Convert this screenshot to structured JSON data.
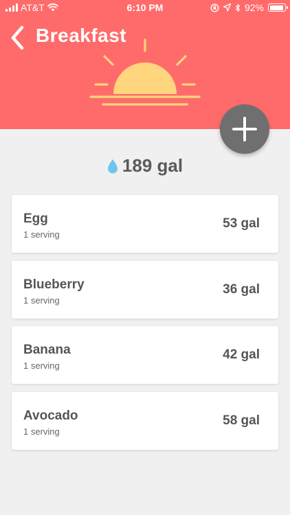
{
  "status": {
    "carrier": "AT&T",
    "time": "6:10 PM",
    "battery": "92%",
    "battery_level": 0.92
  },
  "header": {
    "title": "Breakfast",
    "back_icon": "chevron-left-icon",
    "illustration": "sunrise-icon",
    "background_color": "#ff6b6b",
    "sun_color": "#ffd57e"
  },
  "add_button": {
    "icon": "plus-icon",
    "color": "#6f6f6f"
  },
  "total": {
    "icon": "water-drop-icon",
    "value": "189 gal",
    "drop_color": "#6ec6ee"
  },
  "items": [
    {
      "name": "Egg",
      "serving": "1 serving",
      "amount": "53 gal"
    },
    {
      "name": "Blueberry",
      "serving": "1 serving",
      "amount": "36 gal"
    },
    {
      "name": "Banana",
      "serving": "1 serving",
      "amount": "42 gal"
    },
    {
      "name": "Avocado",
      "serving": "1 serving",
      "amount": "58 gal"
    }
  ]
}
